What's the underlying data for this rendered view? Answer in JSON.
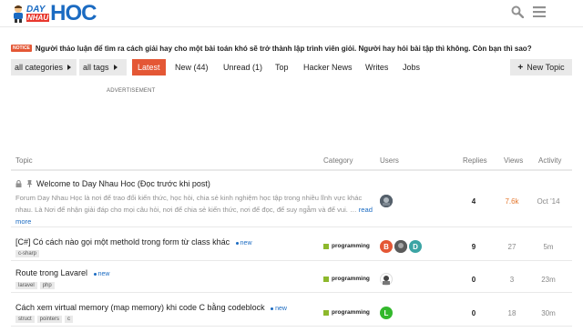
{
  "header": {
    "logo_small_top": "DAY",
    "logo_small_bottom": "NHAU",
    "logo_big": "HOC"
  },
  "notice": {
    "badge": "NOTICE",
    "text": "Người thảo luận để tìm ra cách giải hay cho một bài toán khó sẽ trở thành lập trình viên giỏi. Người hay hỏi bài tập thì không. Còn bạn thì sao?"
  },
  "nav": {
    "categories_label": "all categories",
    "tags_label": "all tags",
    "tabs": [
      "Latest",
      "New (44)",
      "Unread (1)",
      "Top",
      "Hacker News",
      "Writes",
      "Jobs"
    ],
    "new_topic": "New Topic"
  },
  "advertisement": "ADVERTISEMENT",
  "table": {
    "headers": [
      "Topic",
      "Category",
      "Users",
      "Replies",
      "Views",
      "Activity"
    ],
    "rows": [
      {
        "title": "Welcome to Day Nhau Hoc (Đọc trước khi post)",
        "excerpt": "Forum Day Nhau Học là nơi để trao đổi kiến thức, học hỏi, chia sẻ kinh nghiệm học tập trong nhiều lĩnh vực khác nhau. Là Nơi để nhận giải đáp cho mọi câu hỏi, nơi để chia sẻ kiến thức, nơi để đọc, để suy ngẫm và để vui. …",
        "more": "read more",
        "replies": "4",
        "views": "7.6k",
        "activity": "Oct '14"
      },
      {
        "title": "[C#] Có cách nào gọi một methold trong form từ class khác",
        "new": "new",
        "tags": [
          "c-sharp"
        ],
        "category": "programming",
        "avatars": [
          "B",
          "",
          "D"
        ],
        "replies": "9",
        "views": "27",
        "activity": "5m"
      },
      {
        "title": "Route trong Lavarel",
        "new": "new",
        "tags": [
          "laravel",
          "php"
        ],
        "category": "programming",
        "replies": "0",
        "views": "3",
        "activity": "23m"
      },
      {
        "title": "Cách xem virtual memory (map memory) khi code C bằng codeblock",
        "new": "new",
        "tags": [
          "struct",
          "pointers",
          "c"
        ],
        "category": "programming",
        "avatars": [
          "L"
        ],
        "replies": "0",
        "views": "18",
        "activity": "30m"
      }
    ]
  },
  "colors": {
    "accent": "#e45735",
    "link": "#1b6bc2",
    "category": "#8db82c",
    "hot_views": "#e47930"
  }
}
